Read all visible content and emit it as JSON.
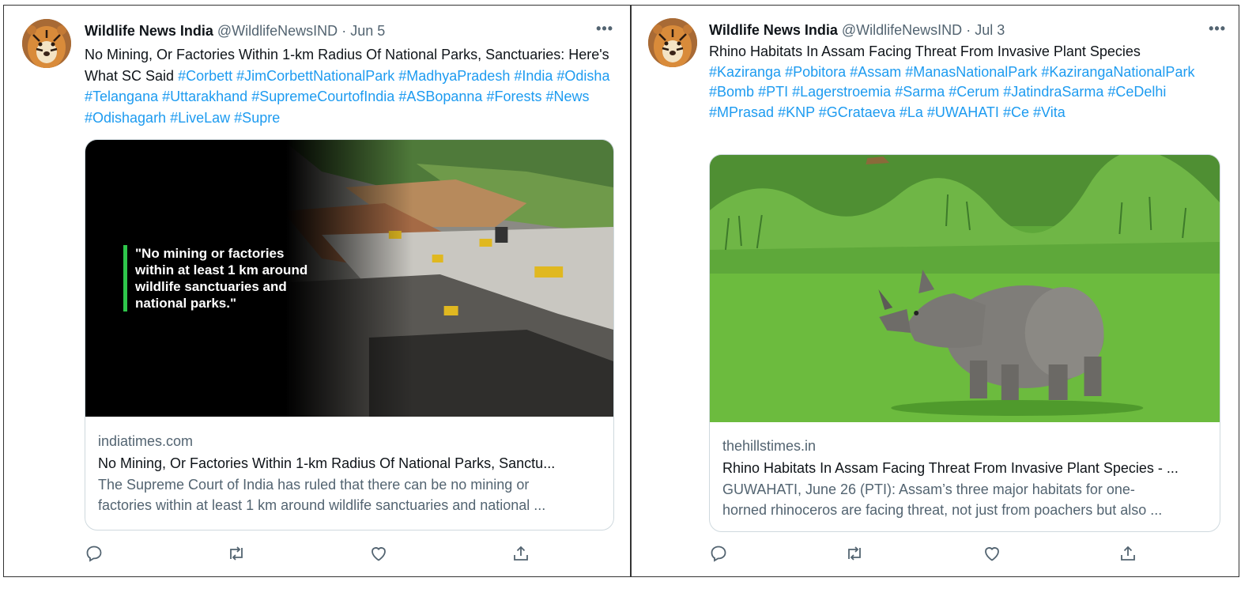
{
  "tweets": [
    {
      "author": {
        "name": "Wildlife News India",
        "handle": "@WildlifeNewsIND",
        "date": "Jun 5"
      },
      "more_label": "•••",
      "text": "No Mining, Or Factories Within 1-km Radius Of National Parks, Sanctuaries: Here's What SC Said",
      "hashtags": [
        "#Corbett",
        "#JimCorbettNationalPark",
        "#MadhyaPradesh",
        "#India",
        "#Odisha",
        "#Telangana",
        "#Uttarakhand",
        "#SupremeCourtofIndia",
        "#ASBopanna",
        "#Forests",
        "#News",
        "#Odishagarh",
        "#LiveLaw",
        "#Supre"
      ],
      "card": {
        "image_quote": "\"No mining or factories within at least 1 km around wildlife sanctuaries and national parks.\"",
        "domain": "indiatimes.com",
        "title": "No Mining, Or Factories Within 1-km Radius Of National Parks, Sanctu...",
        "description_lines": [
          "The Supreme Court of India has ruled that there can be no mining or",
          "factories within at least 1 km around wildlife sanctuaries and national ..."
        ]
      },
      "actions": [
        "reply-icon",
        "retweet-icon",
        "like-icon",
        "share-icon"
      ]
    },
    {
      "author": {
        "name": "Wildlife News India",
        "handle": "@WildlifeNewsIND",
        "date": "Jul 3"
      },
      "more_label": "•••",
      "text": "Rhino Habitats In Assam Facing Threat From Invasive Plant Species",
      "hashtags": [
        "#Kaziranga",
        "#Pobitora",
        "#Assam",
        "#ManasNationalPark",
        "#KazirangaNationalPark",
        "#Bomb",
        "#PTI",
        "#Lagerstroemia",
        "#Sarma",
        "#Cerum",
        "#JatindraSarma",
        "#CeDelhi",
        "#MPrasad",
        "#KNP",
        "#GCrataeva",
        "#La",
        "#UWAHATI",
        "#Ce",
        "#Vita"
      ],
      "card": {
        "domain": "thehillstimes.in",
        "title": "Rhino Habitats In Assam Facing Threat From Invasive Plant Species - ...",
        "description_lines": [
          "GUWAHATI, June 26 (PTI): Assam’s three major habitats for one-",
          "horned rhinoceros are facing threat, not just from poachers but also ..."
        ]
      },
      "actions": [
        "reply-icon",
        "retweet-icon",
        "like-icon",
        "share-icon"
      ]
    }
  ],
  "colors": {
    "link": "#1d9bf0",
    "text": "#0f1419",
    "muted": "#536471",
    "quote_bar": "#2ec64b",
    "card_border": "#cfd9de"
  }
}
